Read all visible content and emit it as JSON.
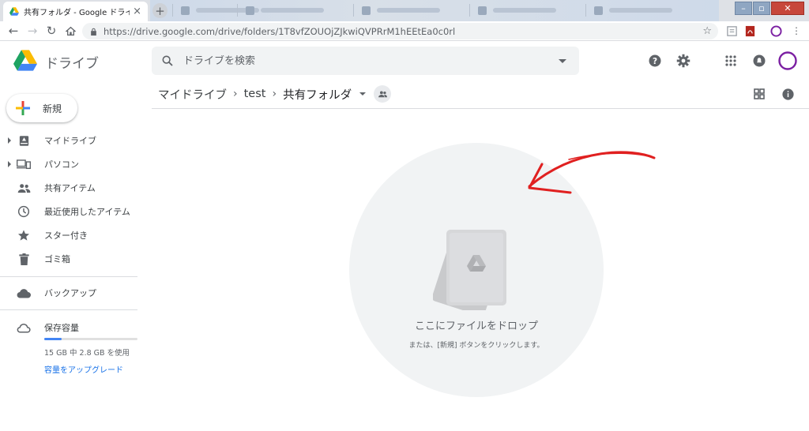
{
  "browser": {
    "active_tab_title": "共有フォルダ - Google ドライブ",
    "url": "https://drive.google.com/drive/folders/1T8vfZOUOjZJkwiQVPRrM1hEEtEa0c0rl",
    "window_controls": {
      "minimize": "–",
      "restore": "▫",
      "close": "✕"
    }
  },
  "app": {
    "brand": "ドライブ",
    "search_placeholder": "ドライブを検索"
  },
  "breadcrumb": [
    "マイドライブ",
    "test",
    "共有フォルダ"
  ],
  "new_button": "新規",
  "nav": {
    "items": [
      {
        "label": "マイドライブ",
        "icon": "my-drive-icon"
      },
      {
        "label": "パソコン",
        "icon": "computers-icon"
      },
      {
        "label": "共有アイテム",
        "icon": "shared-people-icon"
      },
      {
        "label": "最近使用したアイテム",
        "icon": "clock-icon"
      },
      {
        "label": "スター付き",
        "icon": "star-icon"
      },
      {
        "label": "ゴミ箱",
        "icon": "trash-icon"
      }
    ],
    "backup": "バックアップ",
    "storage": {
      "label": "保存容量",
      "usage": "15 GB 中 2.8 GB を使用",
      "used_fraction": 0.19,
      "upgrade": "容量をアップグレード"
    }
  },
  "empty_state": {
    "title": "ここにファイルをドロップ",
    "subtitle": "または、[新規] ボタンをクリックします。"
  },
  "colors": {
    "accent": "#1a73e8",
    "annotation_arrow": "#e02020",
    "profile_ring": "#7b1fa2"
  }
}
